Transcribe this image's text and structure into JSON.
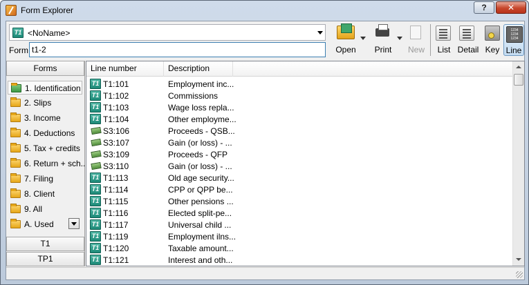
{
  "window": {
    "title": "Form Explorer",
    "help_button": "?",
    "close_button": "✕"
  },
  "name_combo": {
    "icon_text": "T1",
    "value": "<NoName>"
  },
  "form_field": {
    "label": "Form:",
    "value": "t1-2"
  },
  "toolbar": {
    "open": "Open",
    "print": "Print",
    "new": "New",
    "list": "List",
    "detail": "Detail",
    "key": "Key",
    "line": "Line",
    "line_icon_text": "1234 1234 1234"
  },
  "left_panel": {
    "header": "Forms",
    "categories": [
      {
        "label": "1. Identification"
      },
      {
        "label": "2. Slips"
      },
      {
        "label": "3. Income"
      },
      {
        "label": "4. Deductions"
      },
      {
        "label": "5. Tax + credits"
      },
      {
        "label": "6. Return + sch..."
      },
      {
        "label": "7. Filing"
      },
      {
        "label": "8. Client"
      },
      {
        "label": "9. All"
      },
      {
        "label": "A. Used"
      }
    ],
    "tabs": [
      "T1",
      "TP1"
    ]
  },
  "list": {
    "columns": [
      "Line number",
      "Description"
    ],
    "rows": [
      {
        "icon": "t1-form-icon",
        "icon_text": "T1",
        "line": "T1:101",
        "desc": "Employment inc..."
      },
      {
        "icon": "t1-form-icon",
        "icon_text": "T1",
        "line": "T1:102",
        "desc": "Commissions"
      },
      {
        "icon": "t1-form-icon",
        "icon_text": "T1",
        "line": "T1:103",
        "desc": "Wage loss repla..."
      },
      {
        "icon": "t1-form-icon",
        "icon_text": "T1",
        "line": "T1:104",
        "desc": "Other employme..."
      },
      {
        "icon": "money-icon",
        "icon_text": "",
        "line": "S3:106",
        "desc": "Proceeds - QSB..."
      },
      {
        "icon": "money-icon",
        "icon_text": "",
        "line": "S3:107",
        "desc": "Gain (or loss) - ..."
      },
      {
        "icon": "money-icon",
        "icon_text": "",
        "line": "S3:109",
        "desc": "Proceeds - QFP"
      },
      {
        "icon": "money-icon",
        "icon_text": "",
        "line": "S3:110",
        "desc": "Gain (or loss) - ..."
      },
      {
        "icon": "t1-form-icon",
        "icon_text": "T1",
        "line": "T1:113",
        "desc": "Old age security..."
      },
      {
        "icon": "t1-form-icon",
        "icon_text": "T1",
        "line": "T1:114",
        "desc": "CPP or QPP be..."
      },
      {
        "icon": "t1-form-icon",
        "icon_text": "T1",
        "line": "T1:115",
        "desc": "Other pensions ..."
      },
      {
        "icon": "t1-form-icon",
        "icon_text": "T1",
        "line": "T1:116",
        "desc": "Elected split-pe..."
      },
      {
        "icon": "t1-form-icon",
        "icon_text": "T1",
        "line": "T1:117",
        "desc": "Universal child ..."
      },
      {
        "icon": "t1-form-icon",
        "icon_text": "T1",
        "line": "T1:119",
        "desc": "Employment ilns..."
      },
      {
        "icon": "t1-form-icon",
        "icon_text": "T1",
        "line": "T1:120",
        "desc": "Taxable amount..."
      },
      {
        "icon": "t1-form-icon",
        "icon_text": "T1",
        "line": "T1:121",
        "desc": "Interest and oth..."
      }
    ]
  }
}
